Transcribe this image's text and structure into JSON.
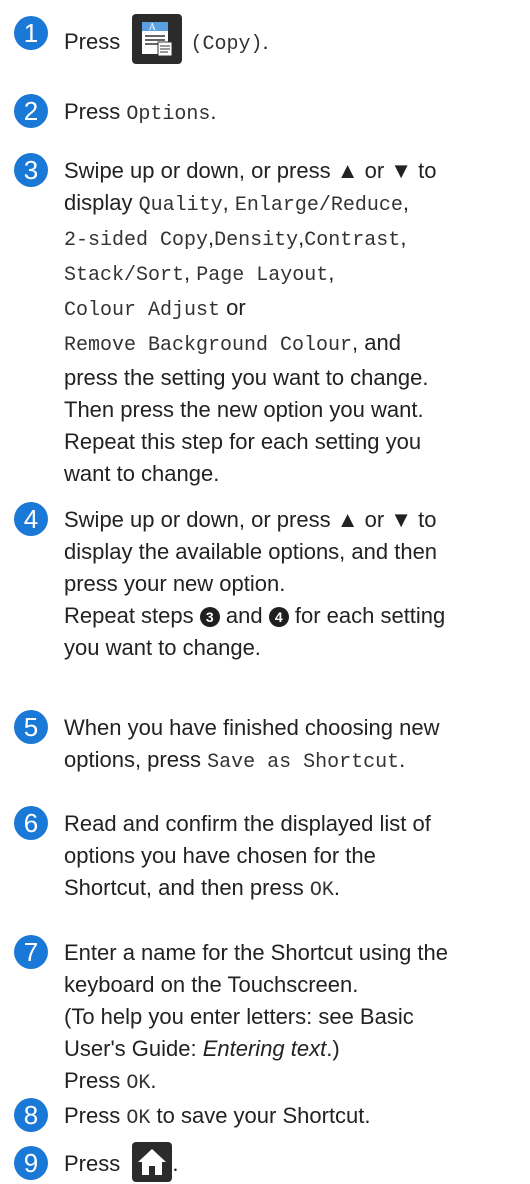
{
  "steps": [
    {
      "num": "1",
      "press": "Press",
      "copy_label": "(Copy)",
      "end": "."
    },
    {
      "num": "2",
      "press": "Press",
      "options": "Options",
      "end": "."
    },
    {
      "num": "3",
      "l1": "Swipe up or down, or press ▲ or ▼ to",
      "l2_pre": "display",
      "quality": "Quality",
      "enlarge": "Enlarge/Reduce",
      "sided": "2-sided Copy",
      "density": "Density",
      "contrast": "Contrast",
      "stack": "Stack/Sort",
      "layout": "Page Layout",
      "colour": "Colour Adjust",
      "or": "or",
      "remove": "Remove Background Colour",
      "and": ", and",
      "l7": "press the setting you want to change.",
      "l8": "Then press the new option you want.",
      "l9": "Repeat this step for each setting you",
      "l10": "want to change."
    },
    {
      "num": "4",
      "l1": "Swipe up or down, or press ▲ or ▼ to",
      "l2": "display the available options, and then",
      "l3": "press your new option.",
      "l4_pre": "Repeat steps",
      "ref3": "3",
      "and": "and",
      "ref4": "4",
      "l4_post": "for each setting",
      "l5": "you want to change."
    },
    {
      "num": "5",
      "l1": "When you have finished choosing new",
      "l2_pre": "options, press",
      "save": "Save as Shortcut",
      "end": "."
    },
    {
      "num": "6",
      "l1": "Read and confirm the displayed list of",
      "l2": "options you have chosen for the",
      "l3_pre": "Shortcut, and then press",
      "ok": "OK",
      "end": "."
    },
    {
      "num": "7",
      "l1": "Enter a name for the Shortcut using the",
      "l2": "keyboard on the Touchscreen.",
      "l3": "(To help you enter letters: see Basic",
      "l4_pre": "User's Guide:",
      "l4_italic": "Entering text",
      "l4_post": ".)",
      "l5_pre": "Press",
      "ok": "OK",
      "end": "."
    },
    {
      "num": "8",
      "pre": "Press",
      "ok": "OK",
      "post": "to save your Shortcut."
    },
    {
      "num": "9",
      "press": "Press",
      "end": "."
    }
  ],
  "colors": {
    "badge": "#1a78d6",
    "icon_bg": "#2b2b2b"
  },
  "icons": {
    "copy": "copy-icon",
    "home": "home-icon"
  }
}
